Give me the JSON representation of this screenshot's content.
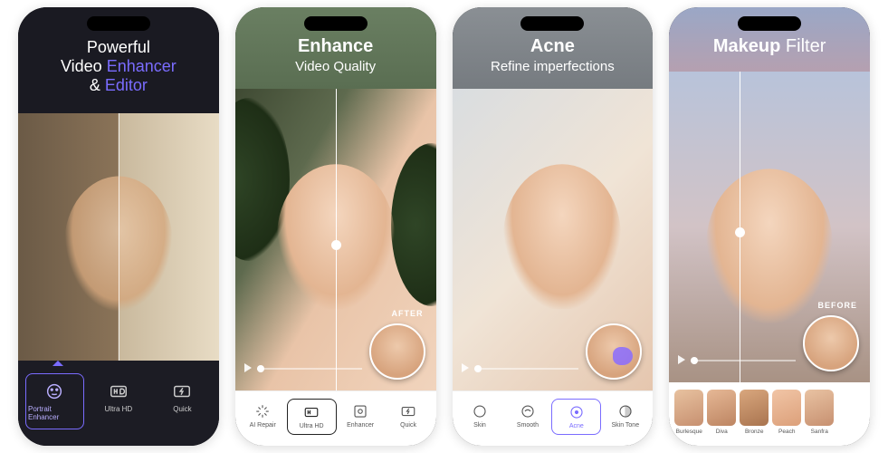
{
  "phone1": {
    "title_l1": "Powerful",
    "title_l2a": "Video ",
    "title_l2b": "Enhancer",
    "title_l3a": "& ",
    "title_l3b": "Editor",
    "modes": [
      {
        "label": "Portrait Enhancer",
        "selected": true
      },
      {
        "label": "Ultra HD",
        "selected": false
      },
      {
        "label": "Quick",
        "selected": false
      }
    ]
  },
  "phone2": {
    "big": "Enhance",
    "small": "Video Quality",
    "badge": "AFTER",
    "tools": [
      {
        "label": "AI Repair",
        "selected": false
      },
      {
        "label": "Ultra HD",
        "selected": true
      },
      {
        "label": "Enhancer",
        "selected": false
      },
      {
        "label": "Quick",
        "selected": false
      }
    ]
  },
  "phone3": {
    "big": "Acne",
    "small": "Refine imperfections",
    "tools": [
      {
        "label": "Skin",
        "selected": false
      },
      {
        "label": "Smooth",
        "selected": false
      },
      {
        "label": "Acne",
        "selected": true
      },
      {
        "label": "Skin Tone",
        "selected": false
      }
    ]
  },
  "phone4": {
    "big": "Makeup",
    "small": " Filter",
    "badge": "BEFORE",
    "filters": [
      "Burlesque",
      "Diva",
      "Bronze",
      "Peach",
      "Sanfra"
    ]
  }
}
